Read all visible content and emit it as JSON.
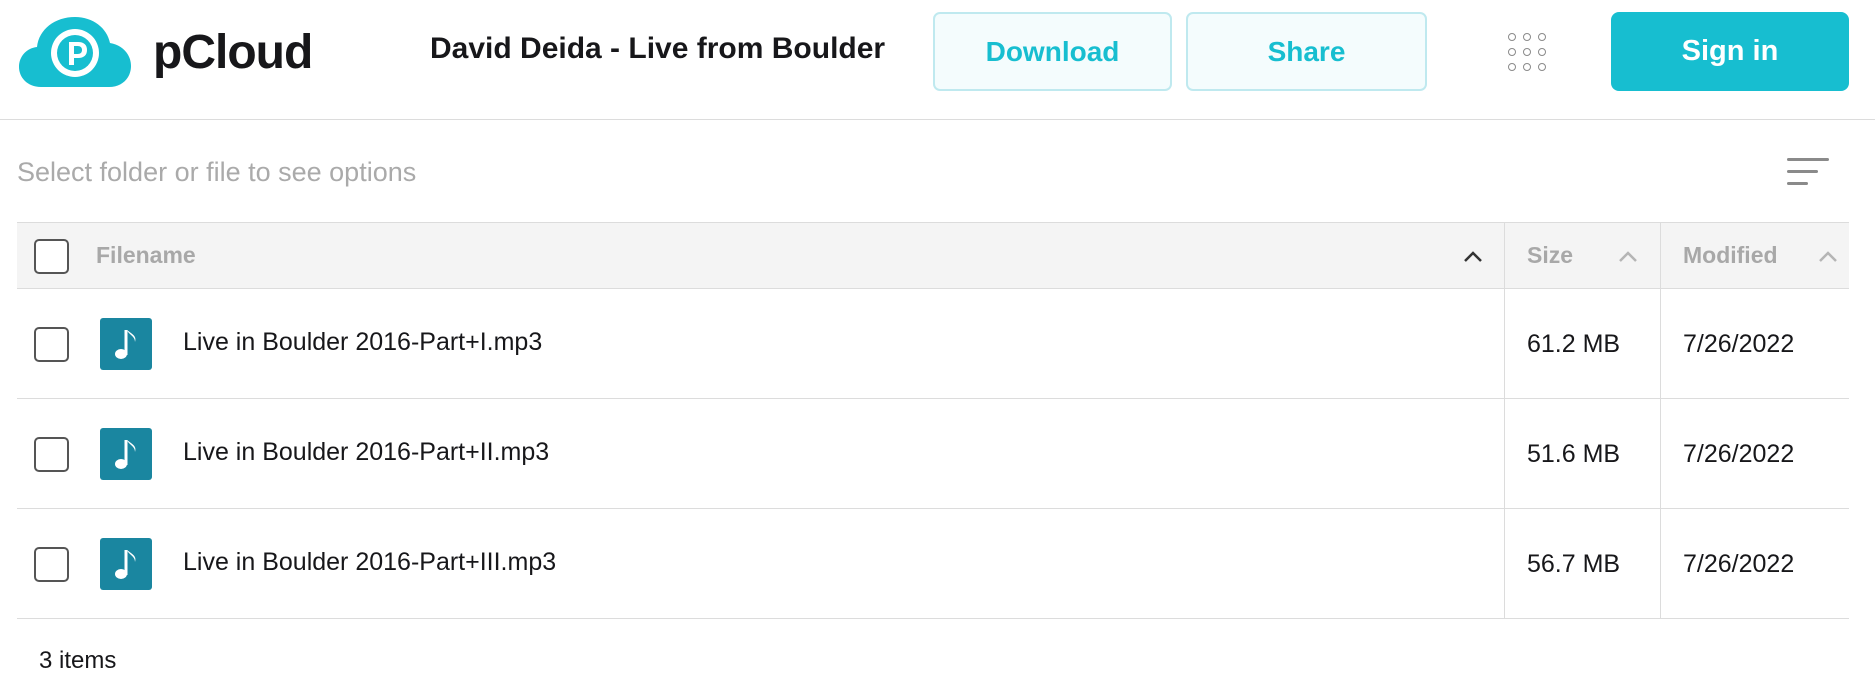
{
  "header": {
    "logo_text": "pCloud",
    "title": "David Deida - Live from Boulder",
    "download_label": "Download",
    "share_label": "Share",
    "signin_label": "Sign in",
    "apps_icon": "grid-icon"
  },
  "toolbar": {
    "hint": "Select folder or file to see options",
    "sort_icon": "sort-lines-icon"
  },
  "table": {
    "columns": {
      "filename": "Filename",
      "size": "Size",
      "modified": "Modified"
    },
    "rows": [
      {
        "name": "Live in Boulder 2016-Part+I.mp3",
        "size": "61.2 MB",
        "modified": "7/26/2022",
        "icon": "music-note-icon"
      },
      {
        "name": "Live in Boulder 2016-Part+II.mp3",
        "size": "51.6 MB",
        "modified": "7/26/2022",
        "icon": "music-note-icon"
      },
      {
        "name": "Live in Boulder 2016-Part+III.mp3",
        "size": "56.7 MB",
        "modified": "7/26/2022",
        "icon": "music-note-icon"
      }
    ]
  },
  "footer": {
    "item_count": "3 items"
  },
  "colors": {
    "accent": "#17bed0",
    "file_icon_bg": "#1a86a0",
    "button_light_bg": "#f4fcfd",
    "button_light_border": "#bfe9ef"
  }
}
